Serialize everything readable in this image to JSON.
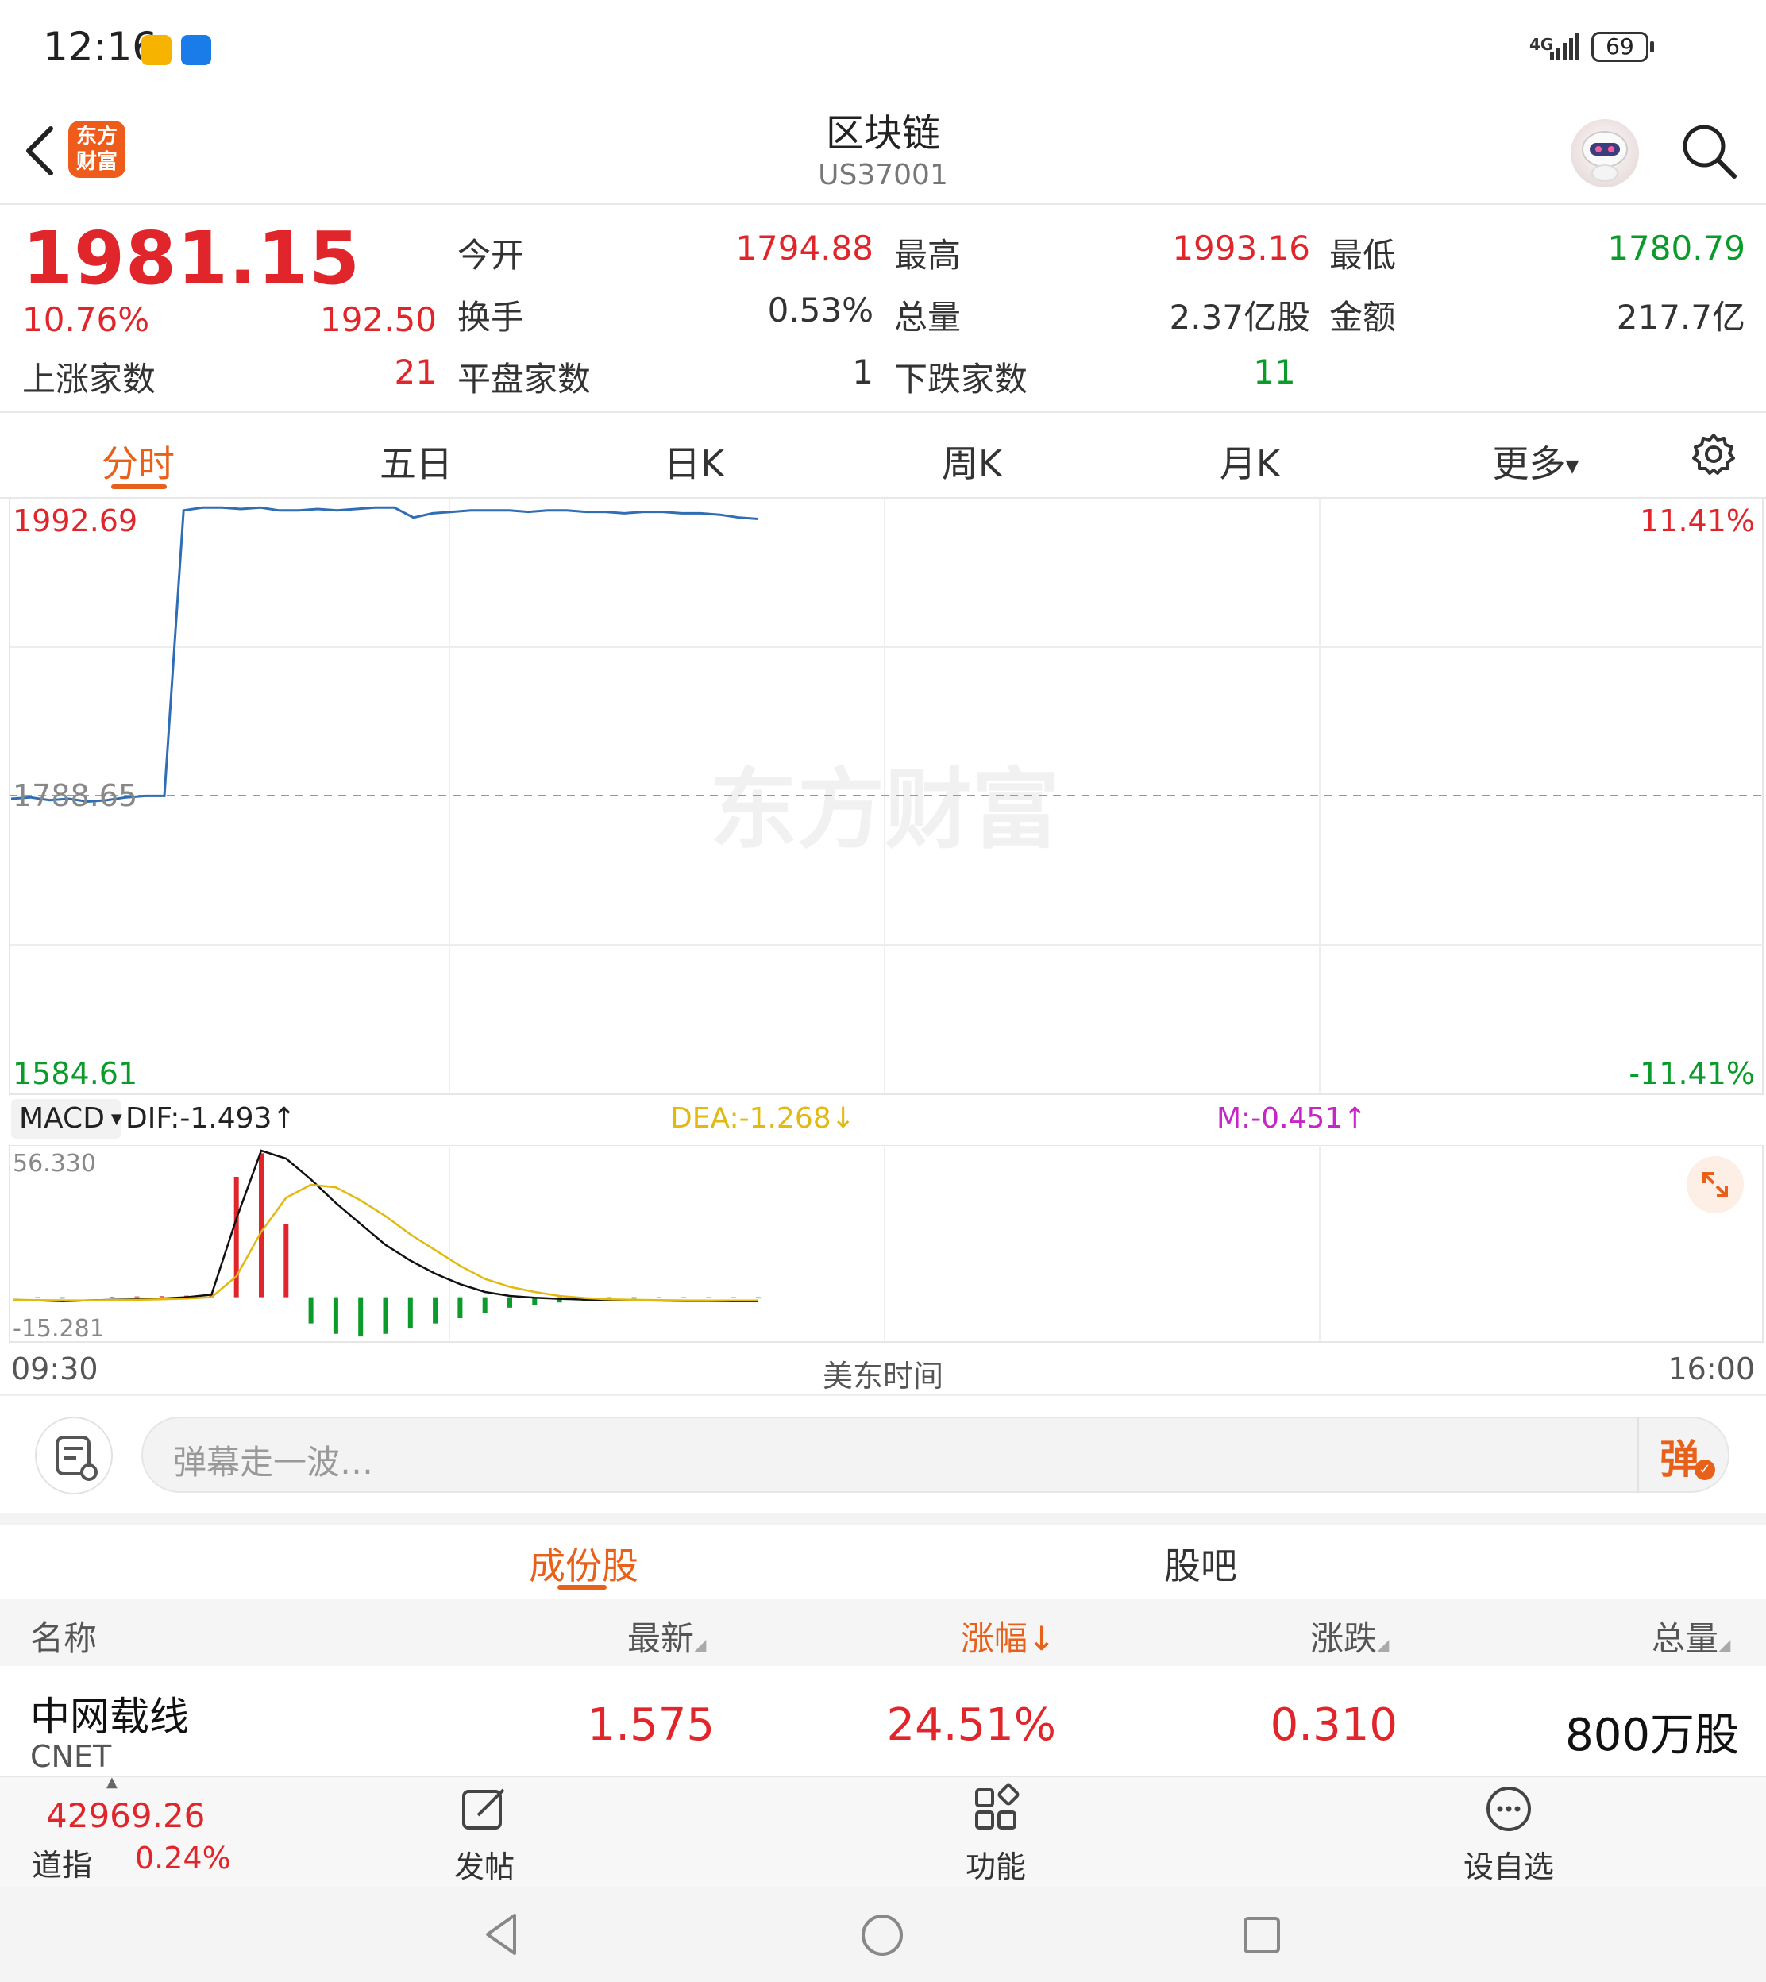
{
  "status_bar": {
    "time": "12:16",
    "network": "4G",
    "battery": "69"
  },
  "header": {
    "title": "区块链",
    "code": "US37001",
    "logo_text": "东方财富",
    "back_icon": "chevron-left-icon",
    "assistant_icon": "robot-avatar-icon",
    "search_icon": "search-icon"
  },
  "quote": {
    "price": "1981.15",
    "change_pct": "10.76%",
    "change": "192.50",
    "rows": [
      [
        {
          "label": "今开",
          "value": "1794.88",
          "color": "red"
        },
        {
          "label": "最高",
          "value": "1993.16",
          "color": "red"
        },
        {
          "label": "最低",
          "value": "1780.79",
          "color": "green"
        }
      ],
      [
        {
          "label": "换手",
          "value": "0.53%",
          "color": "dark"
        },
        {
          "label": "总量",
          "value": "2.37亿股",
          "color": "dark"
        },
        {
          "label": "金额",
          "value": "217.7亿",
          "color": "dark"
        }
      ]
    ],
    "up_count_label": "上涨家数",
    "up_count": "21",
    "flat_count_label": "平盘家数",
    "flat_count": "1",
    "down_count_label": "下跌家数",
    "down_count": "11"
  },
  "tabs": [
    "分时",
    "五日",
    "日K",
    "周K",
    "月K",
    "更多"
  ],
  "active_tab": 0,
  "chart": {
    "high_price": "1992.69",
    "prev_close": "1788.65",
    "low_price": "1584.61",
    "high_pct": "11.41%",
    "low_pct": "-11.41%",
    "watermark": "东方财富",
    "macd_selector": "MACD",
    "dif": "DIF:-1.493",
    "dea": "DEA:-1.268",
    "m": "M:-0.451",
    "macd_max": "56.330",
    "macd_min": "-15.281",
    "time_start": "09:30",
    "time_label": "美东时间",
    "time_end": "16:00",
    "line_color": "#2f6db5",
    "dif_color": "#111111",
    "dea_color": "#e2b90f",
    "up_color": "#e0262b",
    "down_color": "#0a9b2a"
  },
  "chart_data": {
    "type": "line",
    "x_range": [
      "09:30",
      "16:00"
    ],
    "ylim": [
      1584.61,
      1992.69
    ],
    "prev_close": 1788.65,
    "series": [
      {
        "values": [
          1787,
          1788,
          1786,
          1787,
          1785,
          1786,
          1788,
          1789,
          1789,
          1990,
          1992,
          1992,
          1991,
          1992,
          1990,
          1990,
          1991,
          1990,
          1991,
          1992,
          1992,
          1985,
          1988,
          1989,
          1990,
          1990,
          1990,
          1989,
          1990,
          1990,
          1989,
          1989,
          1988,
          1989,
          1989,
          1988,
          1988,
          1987,
          1985,
          1984
        ]
      }
    ],
    "macd": {
      "ylim": [
        -15.281,
        56.33
      ],
      "dif": [
        -1,
        -1.2,
        -1.5,
        -1.2,
        -1,
        -0.8,
        -0.5,
        0,
        1,
        30,
        56,
        53,
        45,
        36,
        28,
        20,
        14,
        9,
        5,
        2,
        0.5,
        -0.2,
        -0.6,
        -0.9,
        -1.1,
        -1.2,
        -1.3,
        -1.4,
        -1.4,
        -1.5,
        -1.5
      ],
      "dea": [
        -1,
        -1.1,
        -1.2,
        -1.2,
        -1.1,
        -1,
        -0.8,
        -0.5,
        0,
        8,
        25,
        38,
        43,
        42,
        37,
        31,
        24,
        18,
        12,
        7,
        4,
        2,
        0.5,
        -0.3,
        -0.8,
        -1,
        -1.1,
        -1.2,
        -1.25,
        -1.27,
        -1.27
      ],
      "m": [
        0,
        -0.2,
        -0.5,
        0,
        0.2,
        0.3,
        0.4,
        0.6,
        1.2,
        46,
        55,
        28,
        -10,
        -14,
        -15,
        -14,
        -12,
        -10,
        -8,
        -6,
        -4,
        -3,
        -2,
        -1.5,
        -1,
        -0.5,
        -0.4,
        -0.3,
        -0.3,
        -0.4,
        -0.45
      ]
    }
  },
  "comment_bar": {
    "placeholder": "弹幕走一波…",
    "danmu_label": "弹"
  },
  "sub_tabs": [
    "成份股",
    "股吧"
  ],
  "active_sub_tab": 0,
  "table": {
    "headers": [
      "名称",
      "最新",
      "涨幅",
      "涨跌",
      "总量"
    ],
    "rows": [
      {
        "name": "中网载线",
        "code": "CNET",
        "latest": "1.575",
        "pct": "24.51%",
        "change": "0.310",
        "volume": "800万股"
      }
    ]
  },
  "bottom_nav": {
    "index_value": "42969.26",
    "index_name": "道指",
    "index_pct": "0.24%",
    "items": [
      {
        "label": "发帖",
        "icon": "edit-icon"
      },
      {
        "label": "功能",
        "icon": "grid-apps-icon"
      },
      {
        "label": "设自选",
        "icon": "more-circle-icon"
      }
    ]
  }
}
